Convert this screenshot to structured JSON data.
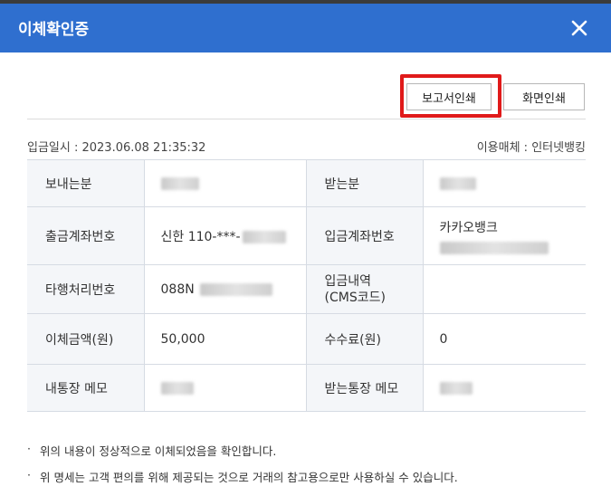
{
  "header": {
    "title": "이체확인증"
  },
  "toolbar": {
    "report_print_label": "보고서인쇄",
    "screen_print_label": "화면인쇄"
  },
  "meta": {
    "deposit_datetime": "입금일시 : 2023.06.08 21:35:32",
    "channel": "이용매체 : 인터넷뱅킹"
  },
  "rows": [
    {
      "label_left": "보내는분",
      "value_left": "",
      "label_right": "받는분",
      "value_right": ""
    },
    {
      "label_left": "출금계좌번호",
      "value_left": "신한 110-***-",
      "label_right": "입금계좌번호",
      "value_right": "카카오뱅크"
    },
    {
      "label_left": "타행처리번호",
      "value_left": "088N",
      "label_right": "입금내역\n(CMS코드)",
      "value_right": ""
    },
    {
      "label_left": "이체금액(원)",
      "value_left": "50,000",
      "label_right": "수수료(원)",
      "value_right": "0"
    },
    {
      "label_left": "내통장 메모",
      "value_left": "",
      "label_right": "받는통장 메모",
      "value_right": ""
    }
  ],
  "notes": [
    "위의 내용이 정상적으로 이체되었음을 확인합니다.",
    "위 명세는 고객 편의를 위해 제공되는 것으로 거래의 참고용으로만 사용하실 수 있습니다."
  ],
  "colors": {
    "header_bg": "#2f6fcf",
    "highlight_border": "#e01a1a",
    "label_bg": "#f4f6f9"
  },
  "icons": {
    "close": "close-icon"
  }
}
